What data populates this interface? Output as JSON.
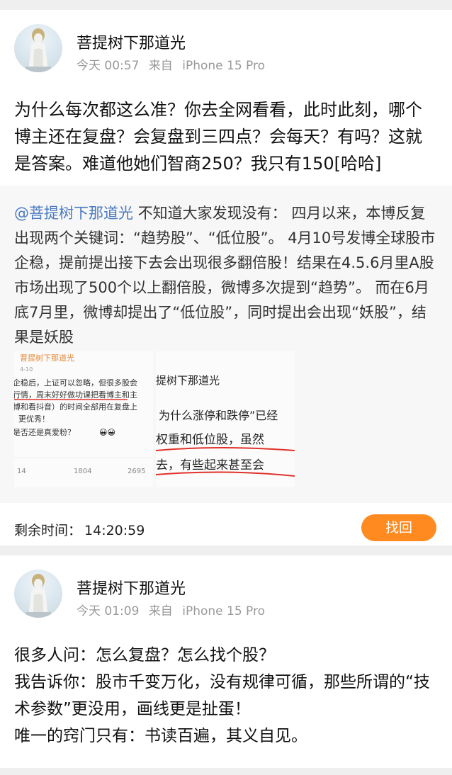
{
  "post1": {
    "author": "菩提树下那道光",
    "time": "今天 00:57",
    "source_prefix": "来自",
    "device": "iPhone 15 Pro",
    "text": "为什么每次都这么准？你去全网看看，此时此刻，哪个博主还在复盘？会复盘到三四点？会每天？有吗？这就是答案。难道他她们智商250？我只有150[哈哈]",
    "repost": {
      "mention": "@菩提树下那道光",
      "text": " 不知道大家发现没有： 四月以来，本博反复出现两个关键词：“趋势股”、“低位股”。 4月10号发博全球股市企稳，提前提出接下去会出现很多翻倍股！结果在4.5.6月里A股市场出现了500个以上翻倍股，微博多次提到“趋势”。 而在6月底7月里，微博却提出了“低位股”，同时提出会出现“妖股”，结果是妖股"
    },
    "thumb1": {
      "header": "菩提树下那道光",
      "date": "4-10",
      "lines": [
        "企稳后，上证可以忽略，但很多股会",
        "行情，周末好好做功课把看博主和主",
        "博和看抖音）的时间全部用在复盘上",
        "更优秀！",
        "是否还是真爱粉？"
      ],
      "emoji": "😀😀",
      "stat_left": "14",
      "stat_mid": "1804",
      "stat_right": "2695"
    },
    "thumb2": {
      "lines": [
        "提树下那道光",
        "为什么涨停和跌停”已经",
        "权重和低位股，虽然",
        "去，有些起来甚至会"
      ]
    },
    "remaining_label": "剩余时间：",
    "remaining_time": "14:20:59",
    "find_button": "找回"
  },
  "post2": {
    "author": "菩提树下那道光",
    "time": "今天 01:09",
    "source_prefix": "来自",
    "device": "iPhone 15 Pro",
    "lines": [
      "很多人问：怎么复盘？怎么找个股？",
      "我告诉你：股市千变万化，没有规律可循，那些所谓的“技术参数”更没用，画线更是扯蛋！",
      "唯一的窍门只有：书读百遍，其义自见。"
    ]
  },
  "colors": {
    "accent_orange": "#ff8a1f",
    "mention_blue": "#4a7ac0",
    "meta_gray": "#999999",
    "background": "#efefef"
  }
}
